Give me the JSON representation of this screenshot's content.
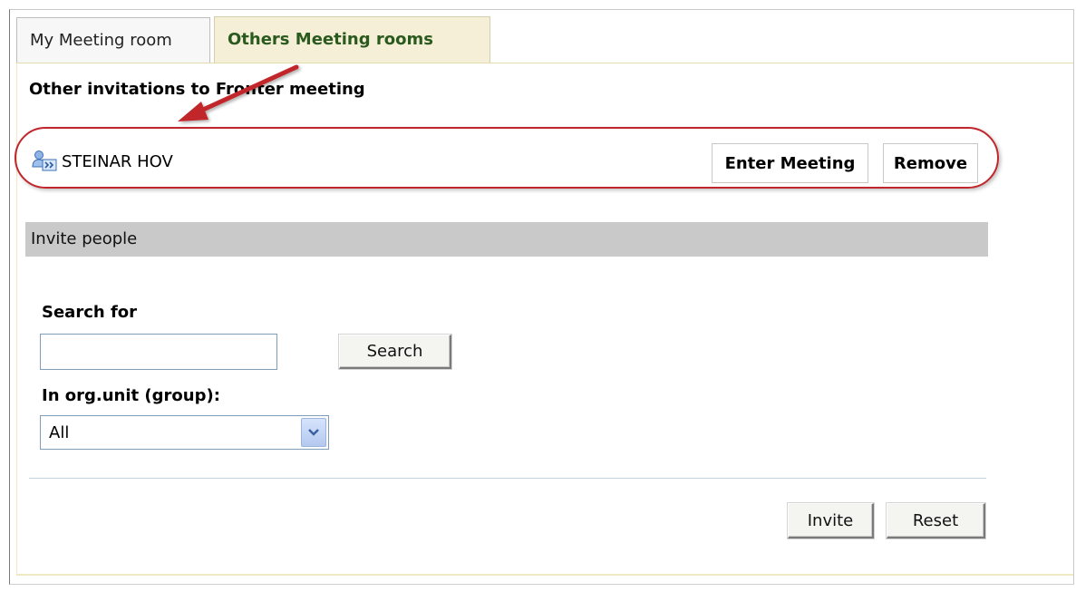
{
  "tabs": [
    {
      "label": "My Meeting room",
      "active": false
    },
    {
      "label": "Others Meeting rooms",
      "active": true
    }
  ],
  "invitations": {
    "heading": "Other invitations to Fronter meeting",
    "items": [
      {
        "name": "STEINAR HOV",
        "enter_label": "Enter Meeting",
        "remove_label": "Remove"
      }
    ]
  },
  "invite_section": {
    "title": "Invite people",
    "search_label": "Search for",
    "search_value": "",
    "search_button": "Search",
    "org_label": "In org.unit (group):",
    "org_selected": "All",
    "invite_button": "Invite",
    "reset_button": "Reset"
  },
  "colors": {
    "highlight": "#c0262b",
    "active_tab_text": "#2b5a1e",
    "active_tab_bg": "#f4efd6",
    "section_bar": "#c9c9c9"
  },
  "icons": {
    "person": "person-icon",
    "dropdown": "chevron-down-icon"
  }
}
